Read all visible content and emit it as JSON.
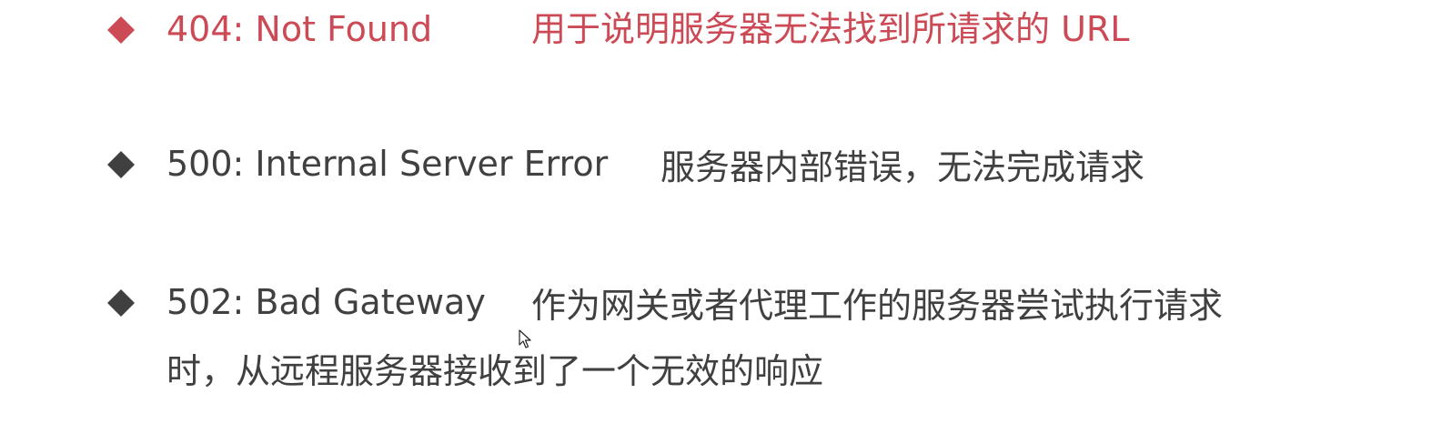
{
  "items": [
    {
      "code": "404: Not Found",
      "description": "用于说明服务器无法找到所请求的 URL",
      "color": "#cc4a55"
    },
    {
      "code": "500: Internal Server Error",
      "description": "服务器内部错误，无法完成请求",
      "color": "#404040"
    },
    {
      "code": "502: Bad Gateway",
      "description": "作为网关或者代理工作的服务器尝试执行请求",
      "description_cont": "时，从远程服务器接收到了一个无效的响应",
      "color": "#404040"
    }
  ],
  "icons": {
    "bullet": "diamond-bullet-icon",
    "cursor": "mouse-pointer-icon"
  }
}
